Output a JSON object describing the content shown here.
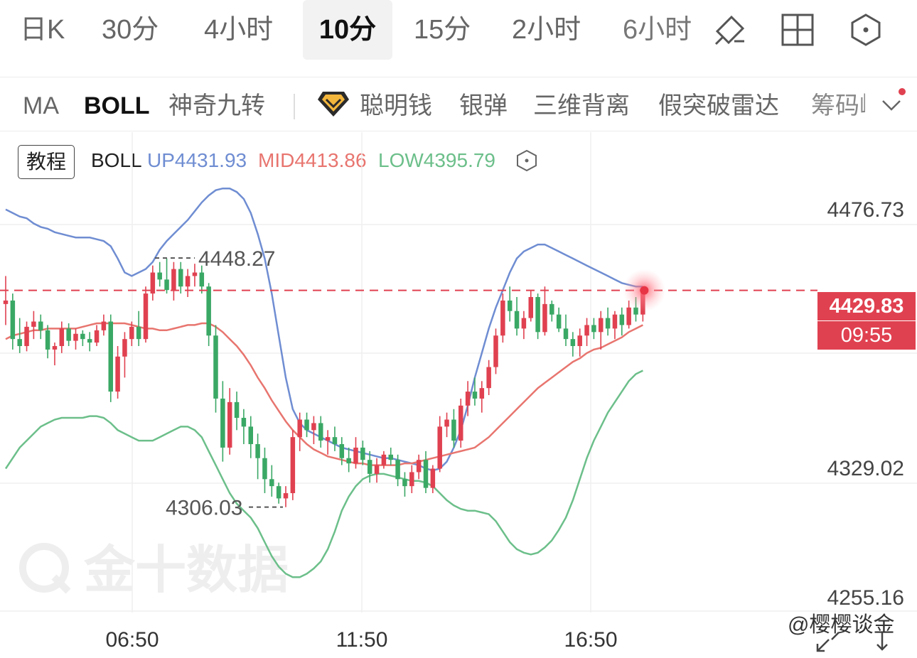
{
  "timeframes": [
    "日K",
    "30分",
    "4小时",
    "10分",
    "15分",
    "2小时",
    "6小时"
  ],
  "active_timeframe": "10分",
  "indicators": [
    "MA",
    "BOLL",
    "神奇九转",
    "聪明钱",
    "银弹",
    "三维背离",
    "假突破雷达",
    "筹码峰"
  ],
  "active_indicator": "BOLL",
  "icons": {
    "draw": "draw-pen-icon",
    "layout": "grid-layout-icon",
    "settings": "hexagon-settings-icon"
  },
  "tutorial_label": "教程",
  "boll_legend": {
    "name": "BOLL",
    "up": "UP4431.93",
    "mid": "MID4413.86",
    "low": "LOW4395.79"
  },
  "current_price": {
    "value": "4429.83",
    "countdown": "09:55"
  },
  "colors": {
    "up": "#e04150",
    "down": "#3aa865",
    "upper_band": "#6f8dd2",
    "mid_band": "#e8756f",
    "lower_band": "#6cbf8a"
  },
  "watermark": "金十数据",
  "footer_credit": "@樱樱谈金",
  "chart_data": {
    "type": "candlestick",
    "interval": "10分",
    "y_ticks": [
      4476.73,
      4329.02,
      4255.16
    ],
    "x_ticks": [
      "06:50",
      "11:50",
      "16:50"
    ],
    "high_marker": "4448.27",
    "low_marker": "4306.03",
    "series": [
      {
        "values": [
          [
            4422,
            4438,
            4410,
            4424
          ],
          [
            4424,
            4428,
            4396,
            4402
          ],
          [
            4402,
            4414,
            4394,
            4398
          ],
          [
            4398,
            4412,
            4395,
            4409
          ],
          [
            4409,
            4418,
            4402,
            4412
          ],
          [
            4412,
            4416,
            4402,
            4407
          ],
          [
            4407,
            4410,
            4391,
            4396
          ],
          [
            4396,
            4400,
            4387,
            4398
          ],
          [
            4398,
            4412,
            4394,
            4408
          ],
          [
            4408,
            4411,
            4398,
            4401
          ],
          [
            4401,
            4408,
            4396,
            4405
          ],
          [
            4405,
            4407,
            4398,
            4402
          ],
          [
            4402,
            4406,
            4395,
            4400
          ],
          [
            4400,
            4410,
            4398,
            4407
          ],
          [
            4407,
            4416,
            4404,
            4412
          ],
          [
            4412,
            4416,
            4366,
            4372
          ],
          [
            4372,
            4398,
            4368,
            4392
          ],
          [
            4392,
            4406,
            4380,
            4402
          ],
          [
            4402,
            4412,
            4398,
            4409
          ],
          [
            4409,
            4418,
            4398,
            4402
          ],
          [
            4402,
            4432,
            4400,
            4428
          ],
          [
            4428,
            4444,
            4424,
            4440
          ],
          [
            4440,
            4446,
            4432,
            4436
          ],
          [
            4436,
            4448,
            4428,
            4430
          ],
          [
            4430,
            4446,
            4424,
            4442
          ],
          [
            4442,
            4446,
            4428,
            4432
          ],
          [
            4432,
            4442,
            4426,
            4438
          ],
          [
            4438,
            4445,
            4432,
            4440
          ],
          [
            4440,
            4444,
            4428,
            4432
          ],
          [
            4432,
            4434,
            4398,
            4404
          ],
          [
            4404,
            4410,
            4360,
            4368
          ],
          [
            4368,
            4378,
            4332,
            4340
          ],
          [
            4340,
            4374,
            4336,
            4366
          ],
          [
            4366,
            4372,
            4350,
            4357
          ],
          [
            4357,
            4362,
            4342,
            4352
          ],
          [
            4352,
            4358,
            4334,
            4342
          ],
          [
            4342,
            4348,
            4322,
            4334
          ],
          [
            4334,
            4340,
            4314,
            4322
          ],
          [
            4322,
            4330,
            4312,
            4318
          ],
          [
            4318,
            4320,
            4308,
            4311
          ],
          [
            4311,
            4318,
            4306,
            4314
          ],
          [
            4314,
            4350,
            4310,
            4346
          ],
          [
            4346,
            4360,
            4338,
            4356
          ],
          [
            4356,
            4360,
            4346,
            4350
          ],
          [
            4350,
            4358,
            4342,
            4354
          ],
          [
            4354,
            4358,
            4340,
            4344
          ],
          [
            4344,
            4350,
            4336,
            4346
          ],
          [
            4346,
            4352,
            4338,
            4342
          ],
          [
            4342,
            4346,
            4330,
            4334
          ],
          [
            4334,
            4340,
            4326,
            4331
          ],
          [
            4331,
            4346,
            4328,
            4340
          ],
          [
            4340,
            4344,
            4330,
            4333
          ],
          [
            4333,
            4338,
            4320,
            4325
          ],
          [
            4325,
            4334,
            4320,
            4330
          ],
          [
            4330,
            4338,
            4328,
            4336
          ],
          [
            4336,
            4340,
            4330,
            4333
          ],
          [
            4333,
            4336,
            4318,
            4322
          ],
          [
            4322,
            4326,
            4312,
            4318
          ],
          [
            4318,
            4330,
            4314,
            4326
          ],
          [
            4326,
            4336,
            4322,
            4333
          ],
          [
            4333,
            4338,
            4314,
            4317
          ],
          [
            4317,
            4330,
            4314,
            4328
          ],
          [
            4328,
            4358,
            4326,
            4352
          ],
          [
            4352,
            4360,
            4346,
            4356
          ],
          [
            4356,
            4362,
            4340,
            4344
          ],
          [
            4344,
            4368,
            4340,
            4364
          ],
          [
            4364,
            4378,
            4358,
            4372
          ],
          [
            4372,
            4380,
            4364,
            4368
          ],
          [
            4368,
            4378,
            4360,
            4374
          ],
          [
            4374,
            4390,
            4370,
            4386
          ],
          [
            4386,
            4408,
            4382,
            4404
          ],
          [
            4404,
            4428,
            4400,
            4424
          ],
          [
            4424,
            4432,
            4412,
            4418
          ],
          [
            4418,
            4426,
            4404,
            4408
          ],
          [
            4408,
            4418,
            4402,
            4414
          ],
          [
            4414,
            4430,
            4412,
            4426
          ],
          [
            4426,
            4428,
            4402,
            4406
          ],
          [
            4406,
            4432,
            4404,
            4422
          ],
          [
            4422,
            4424,
            4412,
            4416
          ],
          [
            4416,
            4420,
            4406,
            4408
          ],
          [
            4408,
            4416,
            4398,
            4402
          ],
          [
            4402,
            4406,
            4392,
            4398
          ],
          [
            4398,
            4408,
            4392,
            4404
          ],
          [
            4404,
            4414,
            4398,
            4410
          ],
          [
            4410,
            4414,
            4402,
            4406
          ],
          [
            4406,
            4418,
            4396,
            4414
          ],
          [
            4414,
            4420,
            4404,
            4408
          ],
          [
            4408,
            4418,
            4402,
            4416
          ],
          [
            4416,
            4420,
            4404,
            4410
          ],
          [
            4410,
            4424,
            4408,
            4420
          ],
          [
            4420,
            4426,
            4412,
            4416
          ],
          [
            4416,
            4432,
            4412,
            4429.83
          ]
        ]
      },
      {
        "name": "UP",
        "values": [
          4476,
          4474,
          4472,
          4471,
          4468,
          4466,
          4465,
          4463,
          4462,
          4461,
          4460,
          4460,
          4460,
          4459,
          4458,
          4455,
          4448,
          4440,
          4438,
          4440,
          4442,
          4446,
          4453,
          4458,
          4462,
          4466,
          4470,
          4475,
          4480,
          4484,
          4487,
          4488,
          4488,
          4486,
          4482,
          4474,
          4462,
          4448,
          4428,
          4404,
          4380,
          4362,
          4354,
          4350,
          4348,
          4346,
          4344,
          4342,
          4340,
          4339,
          4338,
          4337,
          4336,
          4335,
          4334,
          4334,
          4333,
          4332,
          4331,
          4330,
          4328,
          4327,
          4328,
          4332,
          4340,
          4350,
          4364,
          4380,
          4394,
          4408,
          4420,
          4430,
          4440,
          4448,
          4452,
          4454,
          4456,
          4456,
          4454,
          4452,
          4450,
          4448,
          4446,
          4444,
          4442,
          4440,
          4438,
          4436,
          4434,
          4433,
          4432,
          4432
        ]
      },
      {
        "name": "MID",
        "values": [
          4402,
          4404,
          4405,
          4406,
          4407,
          4407,
          4408,
          4408,
          4408,
          4408,
          4408,
          4409,
          4410,
          4411,
          4411,
          4411,
          4411,
          4411,
          4410,
          4409,
          4408,
          4408,
          4407,
          4407,
          4408,
          4409,
          4410,
          4410,
          4411,
          4411,
          4409,
          4406,
          4402,
          4398,
          4393,
          4387,
          4380,
          4374,
          4367,
          4361,
          4355,
          4350,
          4346,
          4342,
          4339,
          4337,
          4335,
          4334,
          4333,
          4332,
          4331,
          4331,
          4330,
          4330,
          4330,
          4330,
          4330,
          4331,
          4331,
          4332,
          4333,
          4334,
          4335,
          4336,
          4337,
          4338,
          4339,
          4340,
          4343,
          4346,
          4350,
          4354,
          4358,
          4362,
          4366,
          4370,
          4374,
          4377,
          4380,
          4383,
          4386,
          4389,
          4391,
          4394,
          4396,
          4397,
          4399,
          4401,
          4403,
          4406,
          4408,
          4410
        ]
      },
      {
        "name": "LOW",
        "values": [
          4328,
          4334,
          4340,
          4344,
          4348,
          4352,
          4354,
          4356,
          4357,
          4357,
          4357,
          4357,
          4358,
          4358,
          4357,
          4354,
          4350,
          4348,
          4346,
          4344,
          4344,
          4344,
          4346,
          4348,
          4350,
          4352,
          4352,
          4350,
          4346,
          4338,
          4330,
          4322,
          4314,
          4308,
          4304,
          4300,
          4294,
          4286,
          4278,
          4272,
          4268,
          4266,
          4266,
          4268,
          4271,
          4275,
          4282,
          4292,
          4304,
          4312,
          4318,
          4322,
          4324,
          4325,
          4325,
          4324,
          4323,
          4322,
          4321,
          4321,
          4320,
          4318,
          4314,
          4310,
          4307,
          4305,
          4304,
          4304,
          4303,
          4302,
          4298,
          4292,
          4286,
          4282,
          4280,
          4279,
          4280,
          4283,
          4287,
          4293,
          4300,
          4310,
          4322,
          4334,
          4344,
          4352,
          4360,
          4366,
          4372,
          4378,
          4382,
          4384
        ]
      }
    ]
  }
}
